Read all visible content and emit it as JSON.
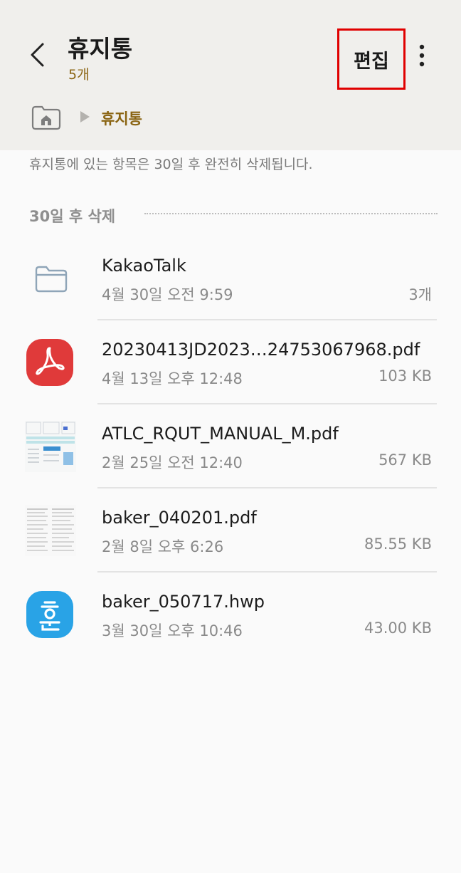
{
  "header": {
    "title": "휴지통",
    "count_label": "5개",
    "edit_label": "편집"
  },
  "breadcrumb": {
    "current": "휴지통"
  },
  "info_text": "휴지통에 있는 항목은 30일 후 완전히 삭제됩니다.",
  "section": {
    "label": "30일 후 삭제"
  },
  "items": [
    {
      "name": "KakaoTalk",
      "date": "4월 30일 오전 9:59",
      "size": "3개",
      "icon": "folder-icon"
    },
    {
      "name": "20230413JD2023…24753067968.pdf",
      "date": "4월 13일 오후 12:48",
      "size": "103 KB",
      "icon": "pdf-icon"
    },
    {
      "name": "ATLC_RQUT_MANUAL_M.pdf",
      "date": "2월 25일 오전 12:40",
      "size": "567 KB",
      "icon": "document-thumbnail"
    },
    {
      "name": "baker_040201.pdf",
      "date": "2월 8일 오후 6:26",
      "size": "85.55 KB",
      "icon": "document-thumbnail"
    },
    {
      "name": "baker_050717.hwp",
      "date": "3월 30일 오후 10:46",
      "size": "43.00 KB",
      "icon": "hwp-icon"
    }
  ],
  "colors": {
    "accent": "#8a6412",
    "header_bg": "#f0efec",
    "highlight_border": "#e00000",
    "pdf_red": "#e03a3a",
    "hwp_blue": "#29a3e6"
  }
}
